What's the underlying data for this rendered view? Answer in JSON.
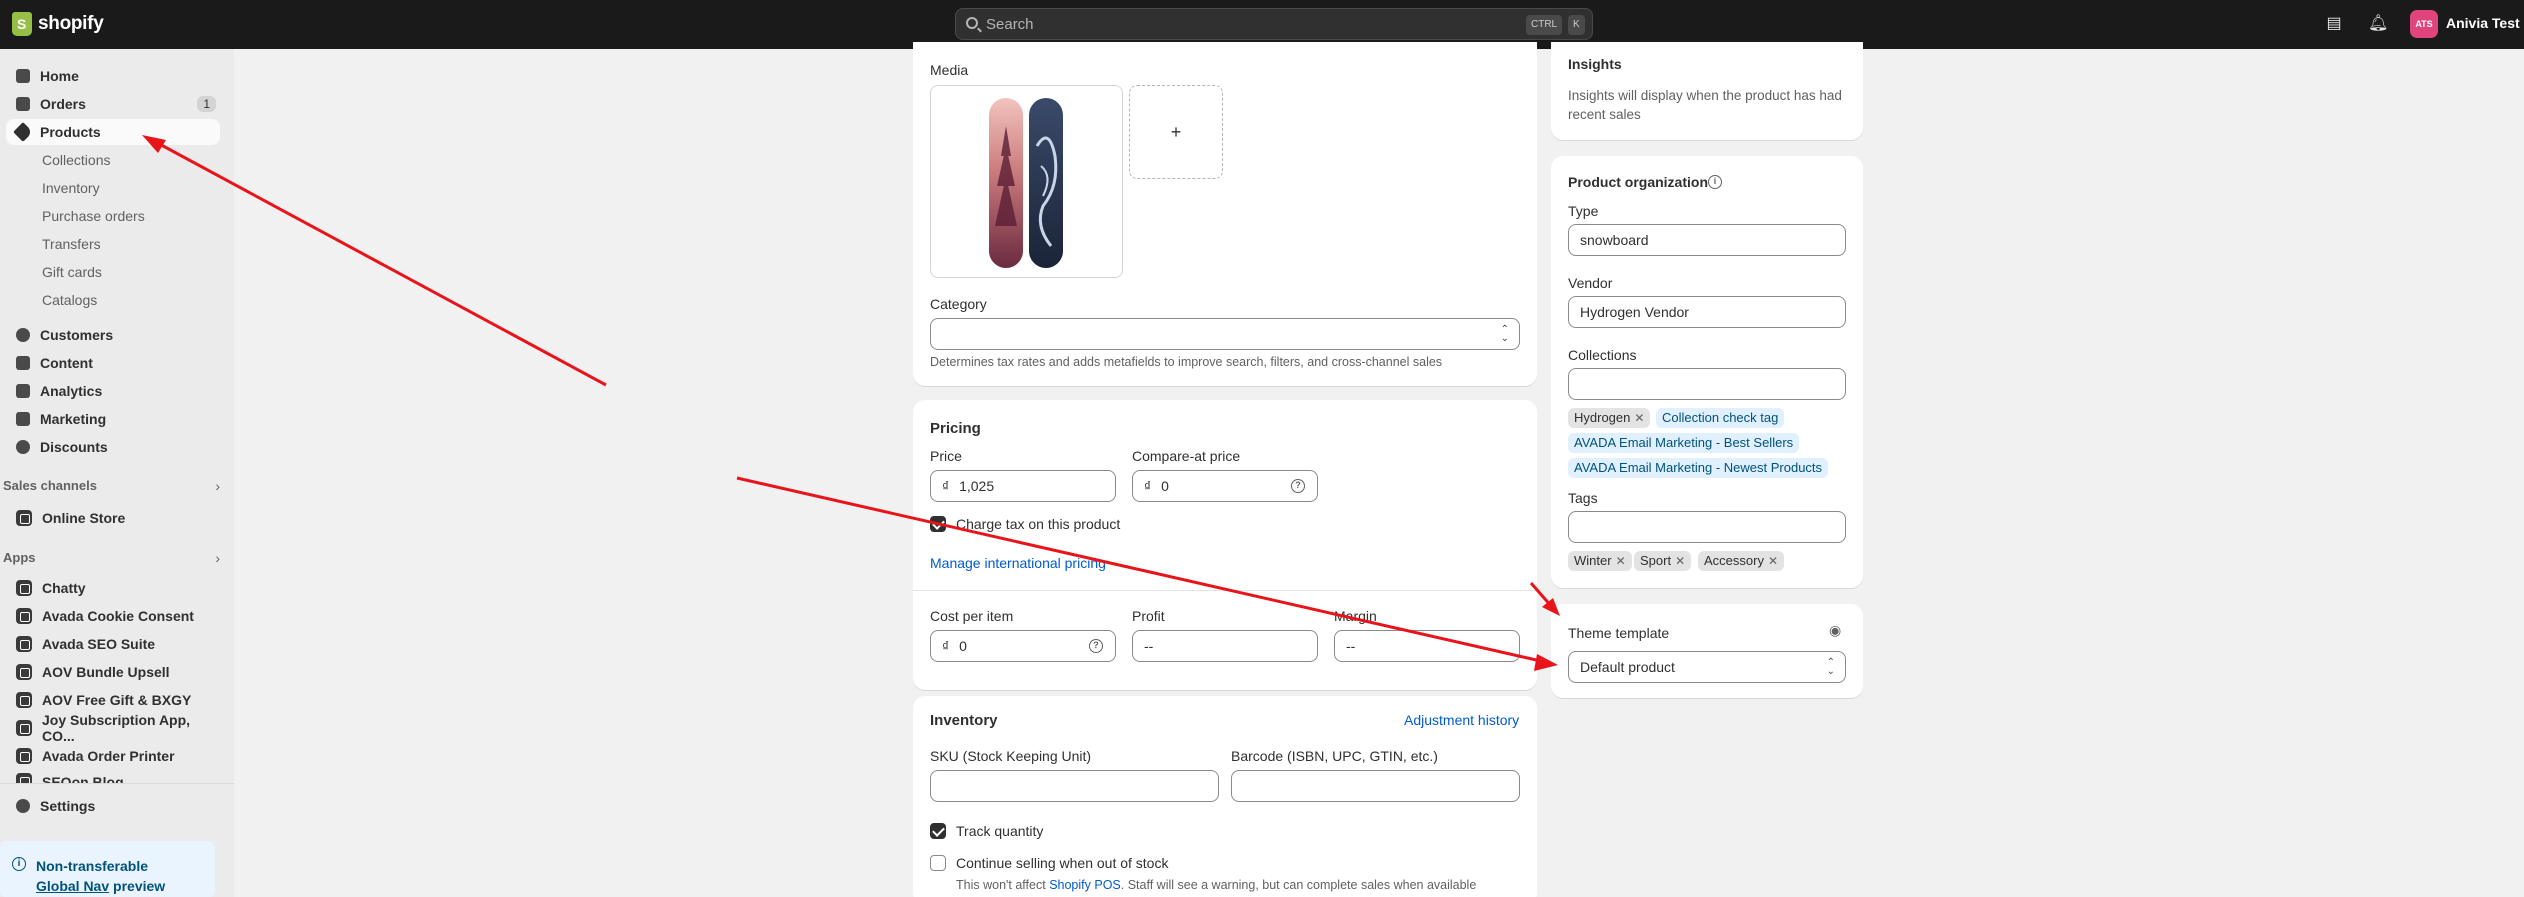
{
  "topbar": {
    "logo_text": "shopify",
    "search_placeholder": "Search",
    "kbd_ctrl": "CTRL",
    "kbd_k": "K",
    "avatar_initials": "ATS",
    "store_name": "Anivia Test Store"
  },
  "sidebar": {
    "main": [
      {
        "label": "Home",
        "icon": "home-icon"
      },
      {
        "label": "Orders",
        "icon": "orders-icon",
        "badge": "1"
      },
      {
        "label": "Products",
        "icon": "tag-icon",
        "active": true
      }
    ],
    "product_sub": [
      "Collections",
      "Inventory",
      "Purchase orders",
      "Transfers",
      "Gift cards",
      "Catalogs"
    ],
    "more": [
      {
        "label": "Customers",
        "icon": "person-icon"
      },
      {
        "label": "Content",
        "icon": "content-icon"
      },
      {
        "label": "Analytics",
        "icon": "analytics-icon"
      },
      {
        "label": "Marketing",
        "icon": "marketing-icon"
      },
      {
        "label": "Discounts",
        "icon": "discount-icon"
      }
    ],
    "sales_channels_header": "Sales channels",
    "online_store": "Online Store",
    "apps_header": "Apps",
    "apps": [
      "Chatty",
      "Avada Cookie Consent",
      "Avada SEO Suite",
      "AOV Bundle Upsell",
      "AOV Free Gift & BXGY",
      "Joy Subscription App, CO...",
      "Avada Order Printer",
      "SEOon Blog"
    ],
    "settings": "Settings",
    "notice_line1": "Non-transferable",
    "notice_link": "Global Nav",
    "notice_line2_suffix": "preview"
  },
  "media": {
    "title": "Media",
    "add": "+",
    "category_label": "Category",
    "category_help": "Determines tax rates and adds metafields to improve search, filters, and cross-channel sales"
  },
  "pricing": {
    "title": "Pricing",
    "price_label": "Price",
    "currency": "₫",
    "price_value": "1,025",
    "compare_label": "Compare-at price",
    "compare_value": "0",
    "charge_tax": "Charge tax on this product",
    "manage_intl": "Manage international pricing",
    "cost_label": "Cost per item",
    "cost_value": "0",
    "profit_label": "Profit",
    "profit_value": "--",
    "margin_label": "Margin",
    "margin_value": "--"
  },
  "inventory": {
    "title": "Inventory",
    "adjustment_history": "Adjustment history",
    "sku_label": "SKU (Stock Keeping Unit)",
    "barcode_label": "Barcode (ISBN, UPC, GTIN, etc.)",
    "track_quantity": "Track quantity",
    "continue_selling": "Continue selling when out of stock",
    "note_prefix": "This won't affect",
    "note_link": "Shopify POS",
    "note_suffix": ". Staff will see a warning, but can complete sales when available"
  },
  "insights": {
    "title": "Insights",
    "body": "Insights will display when the product has had recent sales"
  },
  "organization": {
    "title": "Product organization",
    "type_label": "Type",
    "type_value": "snowboard",
    "vendor_label": "Vendor",
    "vendor_value": "Hydrogen Vendor",
    "collections_label": "Collections",
    "collections": [
      "Hydrogen",
      "Collection check tag",
      "AVADA Email Marketing - Best Sellers",
      "AVADA Email Marketing - Newest Products"
    ],
    "tags_label": "Tags",
    "tags": [
      "Winter",
      "Sport",
      "Accessory"
    ]
  },
  "theme": {
    "label": "Theme template",
    "value": "Default product"
  },
  "colors": {
    "topbar": "#1a1a1a",
    "annotation": "#e8141a",
    "link": "#005bd3"
  }
}
